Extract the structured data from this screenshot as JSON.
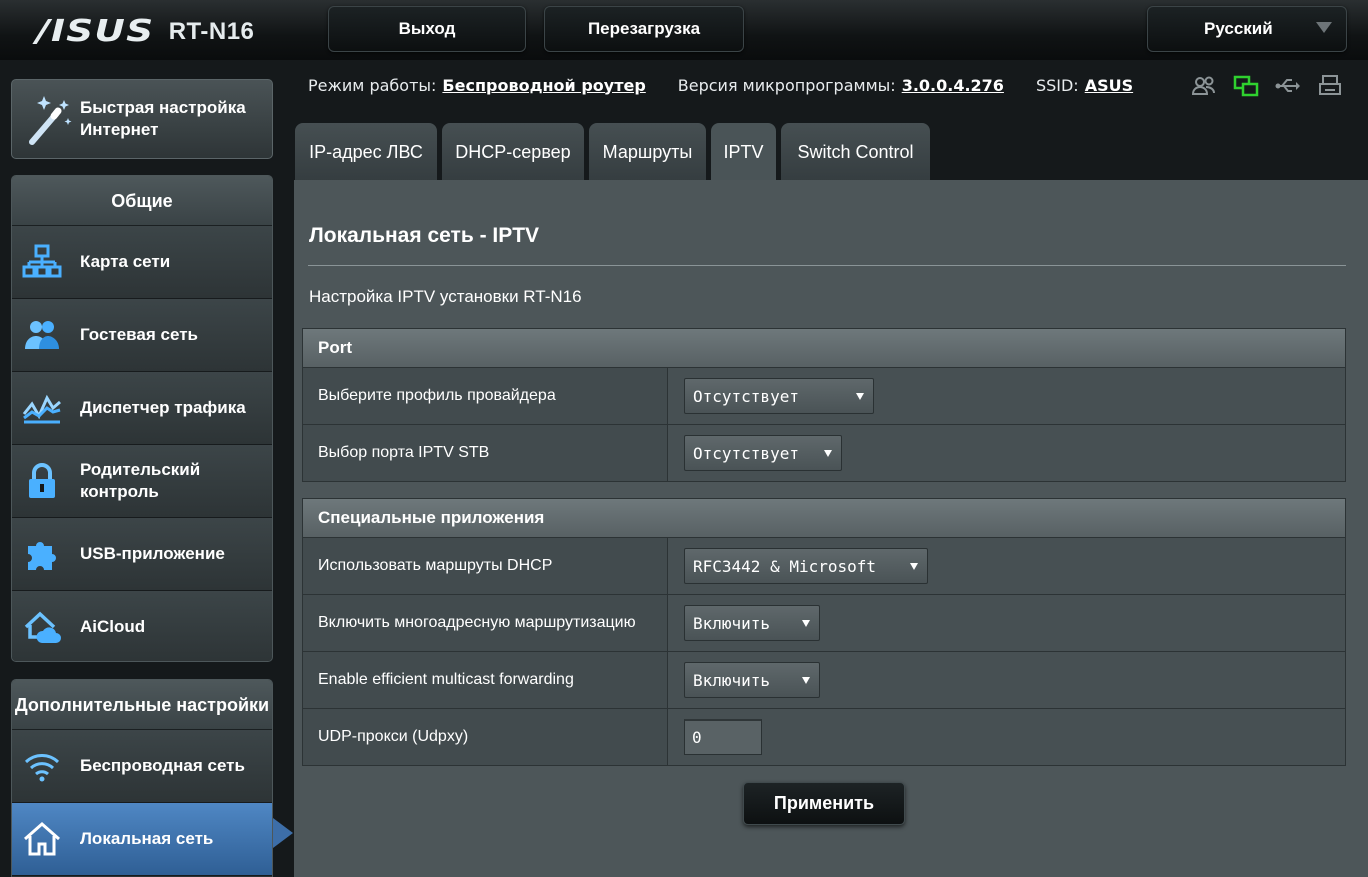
{
  "header": {
    "brand": "/ISUS",
    "model": "RT-N16",
    "logout_label": "Выход",
    "reboot_label": "Перезагрузка",
    "language_label": "Русский"
  },
  "status": {
    "mode_label": "Режим работы:",
    "mode_value": "Беспроводной роутер",
    "firmware_label": "Версия микропрограммы:",
    "firmware_value": "3.0.0.4.276",
    "ssid_label": "SSID:",
    "ssid_value": "ASUS",
    "icons": [
      "clients-icon",
      "network-icon",
      "usb-icon",
      "printer-icon"
    ],
    "active_icon_color": "#2fd12f"
  },
  "sidebar": {
    "qis_label": "Быстрая настройка Интернет",
    "general_header": "Общие",
    "general_items": [
      {
        "label": "Карта сети",
        "icon": "network-map-icon"
      },
      {
        "label": "Гостевая сеть",
        "icon": "guest-network-icon"
      },
      {
        "label": "Диспетчер трафика",
        "icon": "traffic-manager-icon"
      },
      {
        "label": "Родительский контроль",
        "icon": "lock-icon"
      },
      {
        "label": "USB-приложение",
        "icon": "puzzle-icon"
      },
      {
        "label": "AiCloud",
        "icon": "cloud-home-icon"
      }
    ],
    "advanced_header": "Дополнительные настройки",
    "advanced_items": [
      {
        "label": "Беспроводная сеть",
        "icon": "wifi-icon"
      },
      {
        "label": "Локальная сеть",
        "icon": "home-icon",
        "active": true
      }
    ],
    "active_color": "#4f87c4"
  },
  "tabs": [
    {
      "label": "IP-адрес ЛВС"
    },
    {
      "label": "DHCP-сервер"
    },
    {
      "label": "Маршруты"
    },
    {
      "label": "IPTV",
      "selected": true
    },
    {
      "label": "Switch Control"
    }
  ],
  "main": {
    "title": "Локальная сеть - IPTV",
    "description": "Настройка IPTV установки RT-N16",
    "port_section": {
      "header": "Port",
      "rows": [
        {
          "label": "Выберите профиль провайдера",
          "value": "Отсутствует"
        },
        {
          "label": "Выбор порта IPTV STB",
          "value": "Отсутствует"
        }
      ]
    },
    "special_section": {
      "header": "Специальные приложения",
      "rows": [
        {
          "label": "Использовать маршруты DHCP",
          "value": "RFC3442 & Microsoft"
        },
        {
          "label": "Включить многоадресную маршрутизацию",
          "value": "Включить"
        },
        {
          "label": "Enable efficient multicast forwarding",
          "value": "Включить"
        },
        {
          "label": "UDP-прокси (Udpxy)",
          "value": "0"
        }
      ]
    },
    "apply_label": "Применить"
  }
}
